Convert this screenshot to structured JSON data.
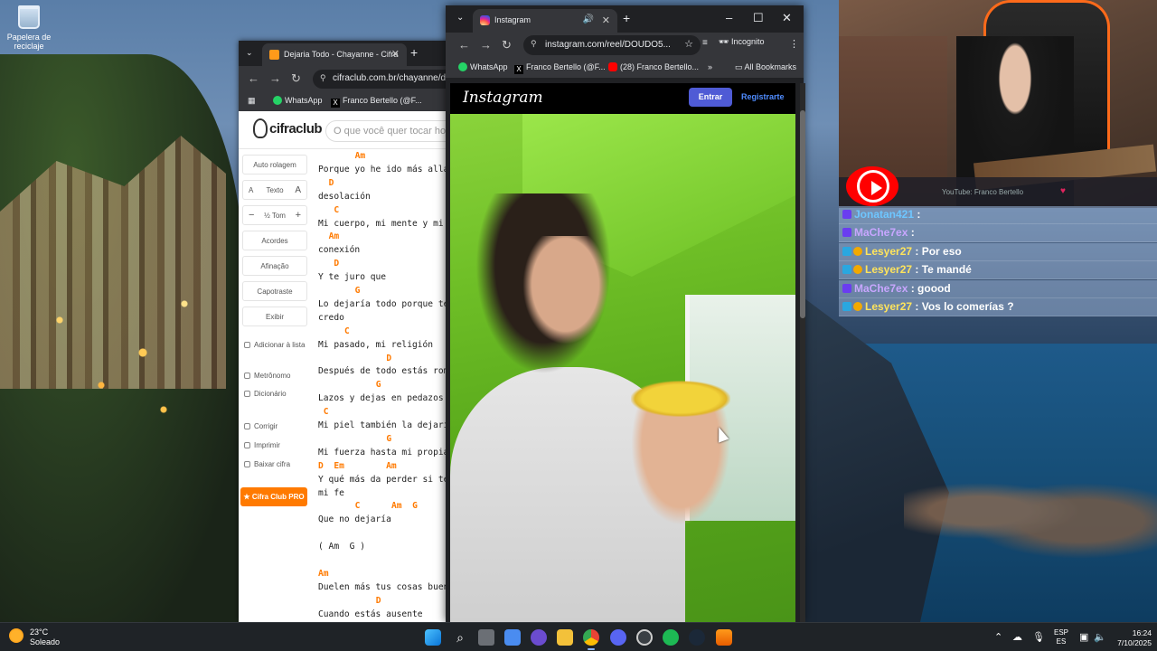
{
  "desktop": {
    "recycle_bin_label": "Papelera de reciclaje"
  },
  "cifra_window": {
    "tab_title": "Dejaria Todo - Chayanne - Cifra",
    "url": "cifraclub.com.br/chayanne/de",
    "bookmarks": [
      "WhatsApp",
      "Franco Bertello (@F..."
    ],
    "logo": "cifraclub",
    "search_placeholder": "O que você quer tocar hoje",
    "controls": {
      "auto_scroll": "Auto rolagem",
      "text_small": "A",
      "text_label": "Texto",
      "text_big": "A",
      "tone_minus": "−",
      "tone_label": "½ Tom",
      "tone_plus": "+",
      "chords": "Acordes",
      "tuning": "Afinação",
      "capo": "Capotraste",
      "show": "Exibir"
    },
    "links": {
      "add_list": "Adicionar à lista",
      "metronome": "Metrônomo",
      "dictionary": "Dicionário",
      "correct": "Corrigir",
      "print": "Imprimir",
      "download": "Baixar cifra"
    },
    "pro_button": "Cifra Club PRO",
    "lines": [
      {
        "type": "chord",
        "text": "Am",
        "indent": 7
      },
      {
        "type": "lyric",
        "text": "Porque yo he ido más allá"
      },
      {
        "type": "chord",
        "text": "D",
        "indent": 2
      },
      {
        "type": "lyric",
        "text": "desolación"
      },
      {
        "type": "chord",
        "text": "C",
        "indent": 3
      },
      {
        "type": "lyric",
        "text": "Mi cuerpo, mi mente y mi"
      },
      {
        "type": "chord",
        "text": "Am",
        "indent": 2
      },
      {
        "type": "lyric",
        "text": "conexión"
      },
      {
        "type": "chord",
        "text": "D",
        "indent": 3
      },
      {
        "type": "lyric",
        "text": "Y te juro que"
      },
      {
        "type": "chord",
        "text": "G",
        "indent": 7
      },
      {
        "type": "lyric",
        "text": "Lo dejaría todo porque te"
      },
      {
        "type": "lyric",
        "text": "credo"
      },
      {
        "type": "chord",
        "text": "C",
        "indent": 5
      },
      {
        "type": "lyric",
        "text": "Mi pasado, mi religión"
      },
      {
        "type": "chord",
        "text": "D",
        "indent": 13
      },
      {
        "type": "lyric",
        "text": "Después de todo estás rom"
      },
      {
        "type": "chord",
        "text": "G",
        "indent": 11
      },
      {
        "type": "lyric",
        "text": "Lazos y dejas en pedazos"
      },
      {
        "type": "chord",
        "text": "C",
        "indent": 1
      },
      {
        "type": "lyric",
        "text": "Mi piel también la dejarí"
      },
      {
        "type": "chord",
        "text": "G",
        "indent": 13
      },
      {
        "type": "lyric",
        "text": "Mi fuerza hasta mi propia"
      },
      {
        "type": "chord",
        "text": "D  Em        Am",
        "indent": 0
      },
      {
        "type": "lyric",
        "text": "Y qué más da perder si te"
      },
      {
        "type": "lyric",
        "text": "mi fe"
      },
      {
        "type": "chord",
        "text": "C      Am  G",
        "indent": 7
      },
      {
        "type": "lyric",
        "text": "Que no dejaría"
      },
      {
        "type": "blank",
        "text": ""
      },
      {
        "type": "lyric",
        "text": "( Am  G )"
      },
      {
        "type": "blank",
        "text": ""
      },
      {
        "type": "chord",
        "text": "Am",
        "indent": 0
      },
      {
        "type": "lyric",
        "text": "Duelen más tus cosas buen"
      },
      {
        "type": "chord",
        "text": "D",
        "indent": 11
      },
      {
        "type": "lyric",
        "text": "Cuando estás ausente"
      }
    ]
  },
  "ig_window": {
    "tab_title": "Instagram",
    "url": "instagram.com/reel/DOUDO5...",
    "incognito_label": "Incognito",
    "bookmarks": [
      "WhatsApp",
      "Franco Bertello (@F...",
      "(28) Franco Bertello..."
    ],
    "all_bookmarks": "All Bookmarks",
    "logo": "Instagram",
    "login_button": "Entrar",
    "signup_link": "Registrarte"
  },
  "stream": {
    "youtube_label": "YouTube: Franco Bertello",
    "chat": [
      {
        "user": "Jonatan421",
        "msg": "",
        "color": "#6ec6ff",
        "badges": [
          "sub"
        ]
      },
      {
        "user": "MaChe7ex",
        "msg": "",
        "color": "#c8a6ff",
        "badges": [
          "sub"
        ]
      },
      {
        "user": "Lesyer27",
        "msg": "Por eso",
        "color": "#ffe45c",
        "badges": [
          "mod",
          "vip"
        ]
      },
      {
        "user": "Lesyer27",
        "msg": "Te mandé",
        "color": "#ffe45c",
        "badges": [
          "mod",
          "vip"
        ]
      },
      {
        "user": "MaChe7ex",
        "msg": "goood",
        "color": "#c8a6ff",
        "badges": [
          "sub"
        ]
      },
      {
        "user": "Lesyer27",
        "msg": "Vos lo comerías ?",
        "color": "#ffe45c",
        "badges": [
          "mod",
          "vip"
        ]
      }
    ]
  },
  "taskbar": {
    "temperature": "23°C",
    "condition": "Soleado",
    "lang_top": "ESP",
    "lang_bottom": "ES",
    "time": "16:24",
    "date": "7/10/2025"
  }
}
